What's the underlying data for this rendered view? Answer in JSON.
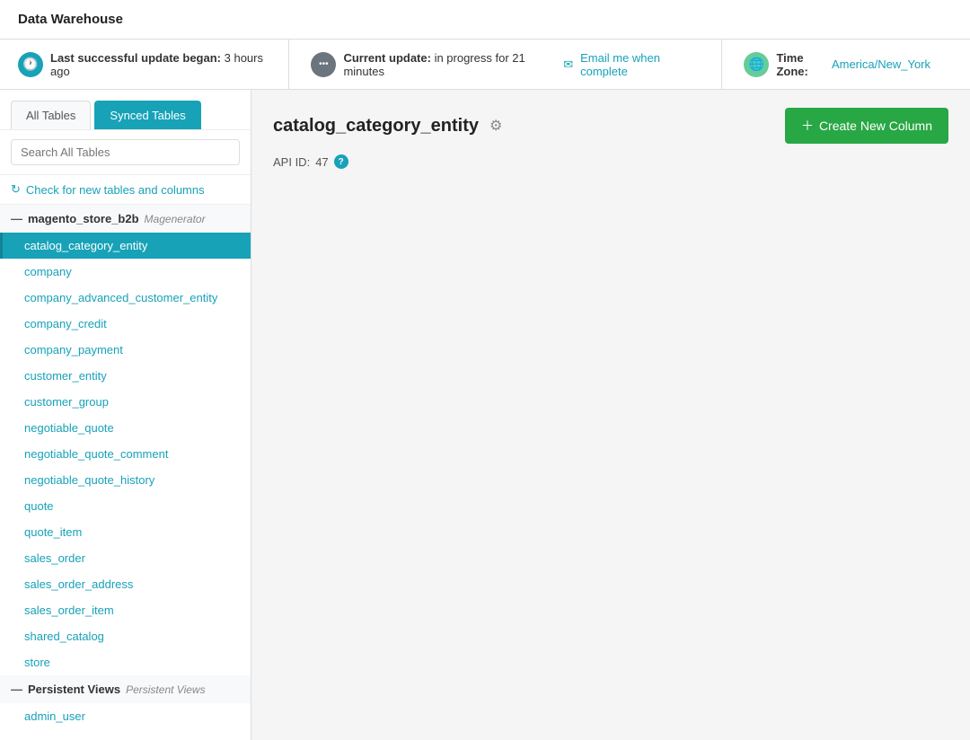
{
  "app": {
    "title": "Data Warehouse"
  },
  "status_bar": {
    "last_update_label": "Last successful update began:",
    "last_update_time": "3 hours ago",
    "current_update_label": "Current update:",
    "current_update_status": "in progress for 21 minutes",
    "email_link": "Email me when complete",
    "timezone_label": "Time Zone:",
    "timezone_value": "America/New_York"
  },
  "sidebar": {
    "tab_all": "All Tables",
    "tab_synced": "Synced Tables",
    "search_placeholder": "Search All Tables",
    "check_link": "Check for new tables and columns",
    "groups": [
      {
        "name": "magento_store_b2b",
        "tag": "Magenerator",
        "tables": [
          "catalog_category_entity",
          "company",
          "company_advanced_customer_entity",
          "company_credit",
          "company_payment",
          "customer_entity",
          "customer_group",
          "negotiable_quote",
          "negotiable_quote_comment",
          "negotiable_quote_history",
          "quote",
          "quote_item",
          "sales_order",
          "sales_order_address",
          "sales_order_item",
          "shared_catalog",
          "store"
        ]
      },
      {
        "name": "Persistent Views",
        "tag": "Persistent Views",
        "tables": [
          "admin_user"
        ]
      }
    ]
  },
  "main": {
    "table_name": "catalog_category_entity",
    "api_id_label": "API ID:",
    "api_id_value": "47",
    "create_btn_label": "Create New Column",
    "active_table": "catalog_category_entity"
  },
  "icons": {
    "refresh": "↻",
    "plus": "+",
    "gear": "⚙",
    "info": "?",
    "clock": "🕐",
    "spinner": "•••",
    "globe": "🌐",
    "envelope": "✉"
  }
}
